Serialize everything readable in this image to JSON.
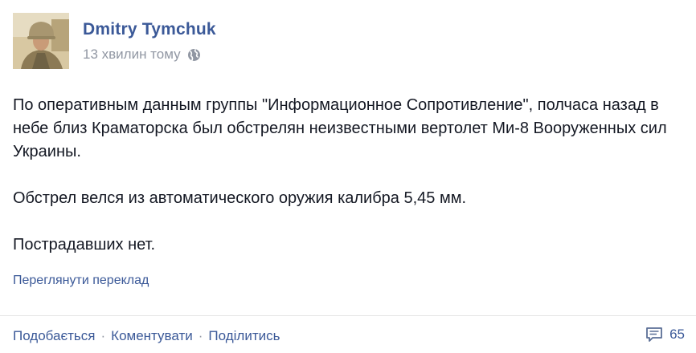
{
  "post": {
    "author": "Dmitry Tymchuk",
    "timestamp": "13 хвилин тому",
    "privacy_icon": "globe-icon",
    "paragraphs": [
      "По оперативным данным группы \"Информационное Сопротивление\", полчаса назад в небе близ Краматорска был обстрелян неизвестными вертолет Ми-8 Вооруженных сил Украины.",
      "Обстрел велся из автоматического оружия калибра 5,45 мм.",
      "Пострадавших нет."
    ],
    "translate_link": "Переглянути переклад"
  },
  "actions": {
    "like": "Подобається",
    "comment": "Коментувати",
    "share": "Поділитись",
    "separator": "·",
    "comment_count": "65",
    "comment_icon": "comment-count-icon"
  },
  "colors": {
    "link": "#3b5998",
    "muted": "#9197a3",
    "text": "#141823",
    "divider": "#e5e5e5"
  }
}
